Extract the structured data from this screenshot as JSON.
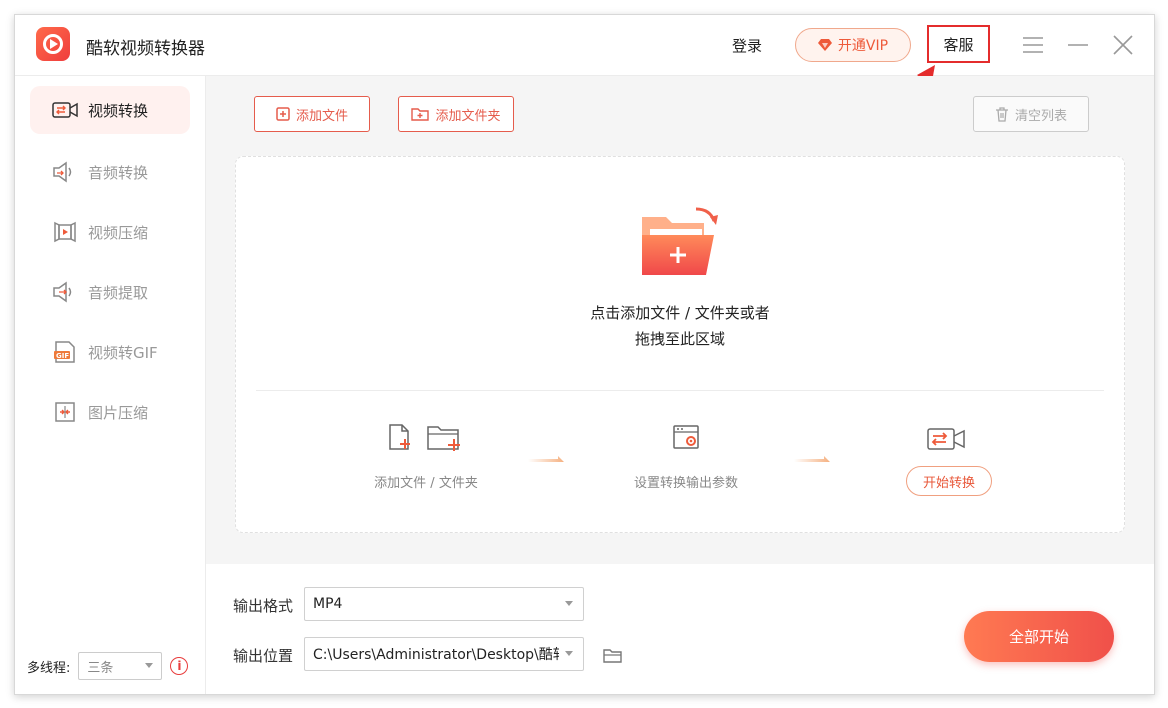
{
  "app": {
    "title": "酷软视频转换器",
    "login": "登录",
    "vip": "开通VIP",
    "service": "客服"
  },
  "colors": {
    "accent": "#ee5a3a",
    "highlight_box": "#e42c2c",
    "active_nav_bg": "#fff1ef"
  },
  "sidebar": {
    "items": [
      {
        "label": "视频转换",
        "icon": "video-convert-icon",
        "active": true
      },
      {
        "label": "音频转换",
        "icon": "audio-convert-icon",
        "active": false
      },
      {
        "label": "视频压缩",
        "icon": "video-compress-icon",
        "active": false
      },
      {
        "label": "音频提取",
        "icon": "audio-extract-icon",
        "active": false
      },
      {
        "label": "视频转GIF",
        "icon": "gif-icon",
        "active": false
      },
      {
        "label": "图片压缩",
        "icon": "image-compress-icon",
        "active": false
      }
    ],
    "threads_label": "多线程:",
    "threads_value": "三条"
  },
  "toolbar": {
    "add_file": "添加文件",
    "add_folder": "添加文件夹",
    "clear_list": "清空列表"
  },
  "dropzone": {
    "line1": "点击添加文件 / 文件夹或者",
    "line2": "拖拽至此区域",
    "steps": [
      {
        "label": "添加文件 / 文件夹"
      },
      {
        "label": "设置转换输出参数"
      },
      {
        "label": "开始转换"
      }
    ]
  },
  "output": {
    "format_label": "输出格式",
    "format_value": "MP4",
    "location_label": "输出位置",
    "location_value": "C:\\Users\\Administrator\\Desktop\\酷软"
  },
  "start_all": "全部开始"
}
